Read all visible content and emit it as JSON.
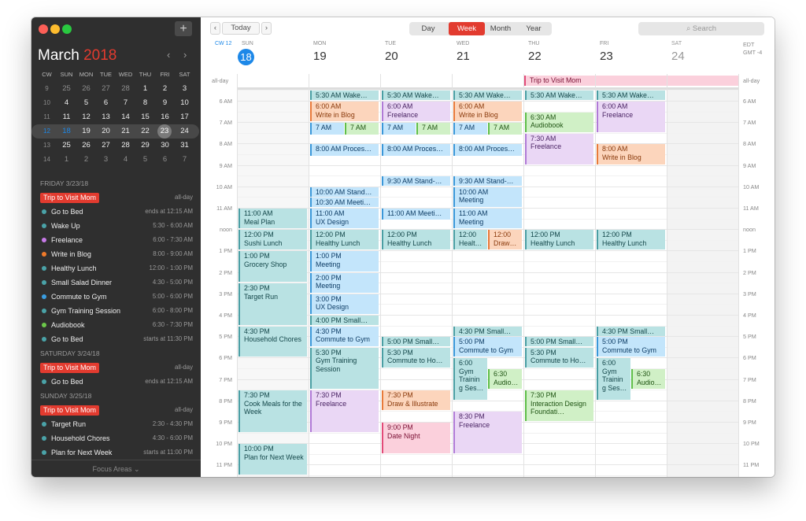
{
  "sidebar": {
    "month": "March",
    "year": "2018",
    "mini_headers": [
      "CW",
      "SUN",
      "MON",
      "TUE",
      "WED",
      "THU",
      "FRI",
      "SAT"
    ],
    "mini_weeks": [
      {
        "cw": "9",
        "days": [
          "25",
          "26",
          "27",
          "28",
          "1",
          "2",
          "3"
        ]
      },
      {
        "cw": "10",
        "days": [
          "4",
          "5",
          "6",
          "7",
          "8",
          "9",
          "10"
        ]
      },
      {
        "cw": "11",
        "days": [
          "11",
          "12",
          "13",
          "14",
          "15",
          "16",
          "17"
        ]
      },
      {
        "cw": "12",
        "days": [
          "18",
          "19",
          "20",
          "21",
          "22",
          "23",
          "24"
        ]
      },
      {
        "cw": "13",
        "days": [
          "25",
          "26",
          "27",
          "28",
          "29",
          "30",
          "31"
        ]
      },
      {
        "cw": "14",
        "days": [
          "1",
          "2",
          "3",
          "4",
          "5",
          "6",
          "7"
        ]
      }
    ],
    "agenda": [
      {
        "kind": "header",
        "text": "FRIDAY 3/23/18"
      },
      {
        "kind": "pill",
        "text": "Trip to Visit Mom",
        "time": "all-day"
      },
      {
        "kind": "item",
        "text": "Go to Bed",
        "time": "ends at 12:15 AM",
        "color": "#4aa3a8"
      },
      {
        "kind": "item",
        "text": "Wake Up",
        "time": "5:30 - 6:00 AM",
        "color": "#4aa3a8"
      },
      {
        "kind": "item",
        "text": "Freelance",
        "time": "6:00 - 7:30 AM",
        "color": "#c77ae8"
      },
      {
        "kind": "item",
        "text": "Write in Blog",
        "time": "8:00 - 9:00 AM",
        "color": "#f07a2a"
      },
      {
        "kind": "item",
        "text": "Healthy Lunch",
        "time": "12:00 - 1:00 PM",
        "color": "#4aa3a8"
      },
      {
        "kind": "item",
        "text": "Small Salad Dinner",
        "time": "4:30 - 5:00 PM",
        "color": "#4aa3a8"
      },
      {
        "kind": "item",
        "text": "Commute to Gym",
        "time": "5:00 - 6:00 PM",
        "color": "#3a9de0"
      },
      {
        "kind": "item",
        "text": "Gym Training Session",
        "time": "6:00 - 8:00 PM",
        "color": "#4aa3a8"
      },
      {
        "kind": "item",
        "text": "Audiobook",
        "time": "6:30 - 7:30 PM",
        "color": "#6cc84a"
      },
      {
        "kind": "item",
        "text": "Go to Bed",
        "time": "starts at 11:30 PM",
        "color": "#4aa3a8"
      },
      {
        "kind": "header",
        "text": "SATURDAY 3/24/18"
      },
      {
        "kind": "pill",
        "text": "Trip to Visit Mom",
        "time": "all-day"
      },
      {
        "kind": "item",
        "text": "Go to Bed",
        "time": "ends at 12:15 AM",
        "color": "#4aa3a8"
      },
      {
        "kind": "header",
        "text": "SUNDAY 3/25/18"
      },
      {
        "kind": "pill",
        "text": "Trip to Visit Mom",
        "time": "all-day"
      },
      {
        "kind": "item",
        "text": "Target Run",
        "time": "2:30 - 4:30 PM",
        "color": "#4aa3a8"
      },
      {
        "kind": "item",
        "text": "Household Chores",
        "time": "4:30 - 6:00 PM",
        "color": "#4aa3a8"
      },
      {
        "kind": "item",
        "text": "Plan for Next Week",
        "time": "starts at 11:00 PM",
        "color": "#4aa3a8"
      }
    ],
    "focus": "Focus Areas"
  },
  "toolbar": {
    "today": "Today",
    "views": [
      "Day",
      "Week",
      "Month",
      "Year"
    ],
    "active_view": "Week",
    "search": "Search"
  },
  "week": {
    "cw": "CW 12",
    "days": [
      {
        "w": "SUN",
        "d": "18"
      },
      {
        "w": "MON",
        "d": "19"
      },
      {
        "w": "TUE",
        "d": "20"
      },
      {
        "w": "WED",
        "d": "21"
      },
      {
        "w": "THU",
        "d": "22"
      },
      {
        "w": "FRI",
        "d": "23"
      },
      {
        "w": "SAT",
        "d": "24"
      }
    ],
    "tz": [
      "EDT",
      "GMT -4"
    ],
    "allday_label": "all-day",
    "hours": [
      "6 AM",
      "7 AM",
      "8 AM",
      "9 AM",
      "10 AM",
      "11 AM",
      "noon",
      "1 PM",
      "2 PM",
      "3 PM",
      "4 PM",
      "5 PM",
      "6 PM",
      "7 PM",
      "8 PM",
      "9 PM",
      "10 PM",
      "11 PM"
    ],
    "allday_event": "Trip to Visit Mom"
  },
  "events": [
    {
      "day": 0,
      "s": 11,
      "e": 12,
      "lane": 0,
      "lanes": 1,
      "c": "teal",
      "t": "11:00 AM",
      "n": "Meal Plan"
    },
    {
      "day": 0,
      "s": 12,
      "e": 13,
      "lane": 0,
      "lanes": 1,
      "c": "teal",
      "t": "12:00 PM",
      "n": "Sushi Lunch"
    },
    {
      "day": 0,
      "s": 13,
      "e": 14.5,
      "lane": 0,
      "lanes": 1,
      "c": "teal",
      "t": "1:00 PM",
      "n": "Grocery Shop"
    },
    {
      "day": 0,
      "s": 14.5,
      "e": 16.5,
      "lane": 0,
      "lanes": 1,
      "c": "teal",
      "t": "2:30 PM",
      "n": "Target Run"
    },
    {
      "day": 0,
      "s": 16.5,
      "e": 18,
      "lane": 0,
      "lanes": 1,
      "c": "teal",
      "t": "4:30 PM",
      "n": "Household Chores"
    },
    {
      "day": 0,
      "s": 19.5,
      "e": 21.5,
      "lane": 0,
      "lanes": 1,
      "c": "teal",
      "t": "7:30 PM",
      "n": "Cook Meals for the Week"
    },
    {
      "day": 0,
      "s": 22,
      "e": 23.5,
      "lane": 0,
      "lanes": 1,
      "c": "teal",
      "t": "10:00 PM",
      "n": "Plan for Next Week"
    },
    {
      "day": 1,
      "s": 5.5,
      "e": 6,
      "lane": 0,
      "lanes": 1,
      "c": "teal",
      "t": "",
      "n": "5:30 AM Wake…"
    },
    {
      "day": 1,
      "s": 6,
      "e": 7,
      "lane": 0,
      "lanes": 1,
      "c": "peach",
      "t": "6:00 AM",
      "n": "Write in Blog"
    },
    {
      "day": 1,
      "s": 7,
      "e": 7.6,
      "lane": 0,
      "lanes": 2,
      "c": "blue",
      "t": "",
      "n": "7 AM"
    },
    {
      "day": 1,
      "s": 7,
      "e": 7.6,
      "lane": 1,
      "lanes": 2,
      "c": "green",
      "t": "",
      "n": "7 AM"
    },
    {
      "day": 1,
      "s": 8,
      "e": 8.6,
      "lane": 0,
      "lanes": 1,
      "c": "blue",
      "t": "",
      "n": "8:00 AM Proces…"
    },
    {
      "day": 1,
      "s": 10,
      "e": 10.5,
      "lane": 0,
      "lanes": 1,
      "c": "blue",
      "t": "",
      "n": "10:00 AM Stand…"
    },
    {
      "day": 1,
      "s": 10.5,
      "e": 11,
      "lane": 0,
      "lanes": 1,
      "c": "blue",
      "t": "",
      "n": "10:30 AM Meeti…"
    },
    {
      "day": 1,
      "s": 11,
      "e": 12,
      "lane": 0,
      "lanes": 1,
      "c": "blue",
      "t": "11:00 AM",
      "n": "UX Design"
    },
    {
      "day": 1,
      "s": 12,
      "e": 13,
      "lane": 0,
      "lanes": 1,
      "c": "teal",
      "t": "12:00 PM",
      "n": "Healthy Lunch"
    },
    {
      "day": 1,
      "s": 13,
      "e": 14,
      "lane": 0,
      "lanes": 1,
      "c": "blue",
      "t": "1:00 PM",
      "n": "Meeting"
    },
    {
      "day": 1,
      "s": 14,
      "e": 15,
      "lane": 0,
      "lanes": 1,
      "c": "blue",
      "t": "2:00 PM",
      "n": "Meeting"
    },
    {
      "day": 1,
      "s": 15,
      "e": 16,
      "lane": 0,
      "lanes": 1,
      "c": "blue",
      "t": "3:00 PM",
      "n": "UX Design"
    },
    {
      "day": 1,
      "s": 16,
      "e": 16.5,
      "lane": 0,
      "lanes": 1,
      "c": "teal",
      "t": "",
      "n": "4:00 PM Small…"
    },
    {
      "day": 1,
      "s": 16.5,
      "e": 17.5,
      "lane": 0,
      "lanes": 1,
      "c": "blue",
      "t": "4:30 PM",
      "n": "Commute to Gym"
    },
    {
      "day": 1,
      "s": 17.5,
      "e": 19.5,
      "lane": 0,
      "lanes": 1,
      "c": "teal",
      "t": "5:30 PM",
      "n": "Gym Training Session"
    },
    {
      "day": 1,
      "s": 19.5,
      "e": 21.5,
      "lane": 0,
      "lanes": 1,
      "c": "lav",
      "t": "7:30 PM",
      "n": "Freelance"
    },
    {
      "day": 2,
      "s": 5.5,
      "e": 6,
      "lane": 0,
      "lanes": 1,
      "c": "teal",
      "t": "",
      "n": "5:30 AM Wake…"
    },
    {
      "day": 2,
      "s": 6,
      "e": 7,
      "lane": 0,
      "lanes": 1,
      "c": "lav",
      "t": "6:00 AM",
      "n": "Freelance"
    },
    {
      "day": 2,
      "s": 7,
      "e": 7.6,
      "lane": 0,
      "lanes": 2,
      "c": "blue",
      "t": "",
      "n": "7 AM"
    },
    {
      "day": 2,
      "s": 7,
      "e": 7.6,
      "lane": 1,
      "lanes": 2,
      "c": "green",
      "t": "",
      "n": "7 AM"
    },
    {
      "day": 2,
      "s": 8,
      "e": 8.6,
      "lane": 0,
      "lanes": 1,
      "c": "blue",
      "t": "",
      "n": "8:00 AM Proces…"
    },
    {
      "day": 2,
      "s": 9.5,
      "e": 10,
      "lane": 0,
      "lanes": 1,
      "c": "blue",
      "t": "",
      "n": "9:30 AM Stand-…"
    },
    {
      "day": 2,
      "s": 11,
      "e": 11.6,
      "lane": 0,
      "lanes": 1,
      "c": "blue",
      "t": "",
      "n": "11:00 AM Meeti…"
    },
    {
      "day": 2,
      "s": 12,
      "e": 13,
      "lane": 0,
      "lanes": 1,
      "c": "teal",
      "t": "12:00 PM",
      "n": "Healthy Lunch"
    },
    {
      "day": 2,
      "s": 17,
      "e": 17.5,
      "lane": 0,
      "lanes": 1,
      "c": "teal",
      "t": "",
      "n": "5:00 PM Small…"
    },
    {
      "day": 2,
      "s": 17.5,
      "e": 18.5,
      "lane": 0,
      "lanes": 1,
      "c": "teal",
      "t": "5:30 PM",
      "n": "Commute to Ho…"
    },
    {
      "day": 2,
      "s": 19.5,
      "e": 20.5,
      "lane": 0,
      "lanes": 1,
      "c": "peach",
      "t": "7:30 PM",
      "n": "Draw & Illustrate"
    },
    {
      "day": 2,
      "s": 21,
      "e": 22.5,
      "lane": 0,
      "lanes": 1,
      "c": "pink",
      "t": "9:00 PM",
      "n": "Date Night"
    },
    {
      "day": 3,
      "s": 5.5,
      "e": 6,
      "lane": 0,
      "lanes": 1,
      "c": "teal",
      "t": "",
      "n": "5:30 AM Wake…"
    },
    {
      "day": 3,
      "s": 6,
      "e": 7,
      "lane": 0,
      "lanes": 1,
      "c": "peach",
      "t": "6:00 AM",
      "n": "Write in Blog"
    },
    {
      "day": 3,
      "s": 7,
      "e": 7.6,
      "lane": 0,
      "lanes": 2,
      "c": "blue",
      "t": "",
      "n": "7 AM"
    },
    {
      "day": 3,
      "s": 7,
      "e": 7.6,
      "lane": 1,
      "lanes": 2,
      "c": "green",
      "t": "",
      "n": "7 AM"
    },
    {
      "day": 3,
      "s": 8,
      "e": 8.6,
      "lane": 0,
      "lanes": 1,
      "c": "blue",
      "t": "",
      "n": "8:00 AM Proces…"
    },
    {
      "day": 3,
      "s": 9.5,
      "e": 10,
      "lane": 0,
      "lanes": 1,
      "c": "blue",
      "t": "",
      "n": "9:30 AM Stand-…"
    },
    {
      "day": 3,
      "s": 10,
      "e": 11,
      "lane": 0,
      "lanes": 1,
      "c": "blue",
      "t": "10:00 AM",
      "n": "Meeting"
    },
    {
      "day": 3,
      "s": 11,
      "e": 12,
      "lane": 0,
      "lanes": 1,
      "c": "blue",
      "t": "11:00 AM",
      "n": "Meeting"
    },
    {
      "day": 3,
      "s": 12,
      "e": 13,
      "lane": 0,
      "lanes": 2,
      "c": "teal",
      "t": "12:00",
      "n": "Healt…"
    },
    {
      "day": 3,
      "s": 12,
      "e": 13,
      "lane": 1,
      "lanes": 2,
      "c": "peach",
      "t": "12:00",
      "n": "Draw…"
    },
    {
      "day": 3,
      "s": 16.5,
      "e": 17,
      "lane": 0,
      "lanes": 1,
      "c": "teal",
      "t": "",
      "n": "4:30 PM Small…"
    },
    {
      "day": 3,
      "s": 17,
      "e": 18,
      "lane": 0,
      "lanes": 1,
      "c": "blue",
      "t": "5:00 PM",
      "n": "Commute to Gym"
    },
    {
      "day": 3,
      "s": 18,
      "e": 20,
      "lane": 0,
      "lanes": 2,
      "c": "teal",
      "t": "6:00",
      "n": "Gym Trainin g Ses…"
    },
    {
      "day": 3,
      "s": 18.5,
      "e": 19.5,
      "lane": 1,
      "lanes": 2,
      "c": "green",
      "t": "6:30",
      "n": "Audio…"
    },
    {
      "day": 3,
      "s": 20.5,
      "e": 22.5,
      "lane": 0,
      "lanes": 1,
      "c": "lav",
      "t": "8:30 PM",
      "n": "Freelance"
    },
    {
      "day": 4,
      "s": 5.5,
      "e": 6,
      "lane": 0,
      "lanes": 1,
      "c": "teal",
      "t": "",
      "n": "5:30 AM Wake…"
    },
    {
      "day": 4,
      "s": 6.5,
      "e": 7.5,
      "lane": 0,
      "lanes": 1,
      "c": "green",
      "t": "6:30 AM",
      "n": "Audiobook"
    },
    {
      "day": 4,
      "s": 7.5,
      "e": 9,
      "lane": 0,
      "lanes": 1,
      "c": "lav",
      "t": "7:30 AM",
      "n": "Freelance"
    },
    {
      "day": 4,
      "s": 12,
      "e": 13,
      "lane": 0,
      "lanes": 1,
      "c": "teal",
      "t": "12:00 PM",
      "n": "Healthy Lunch"
    },
    {
      "day": 4,
      "s": 17,
      "e": 17.5,
      "lane": 0,
      "lanes": 1,
      "c": "teal",
      "t": "",
      "n": "5:00 PM Small…"
    },
    {
      "day": 4,
      "s": 17.5,
      "e": 18.5,
      "lane": 0,
      "lanes": 1,
      "c": "teal",
      "t": "5:30 PM",
      "n": "Commute to Ho…"
    },
    {
      "day": 4,
      "s": 19.5,
      "e": 21,
      "lane": 0,
      "lanes": 1,
      "c": "green",
      "t": "7:30 PM",
      "n": "Interaction Design Foundati…"
    },
    {
      "day": 5,
      "s": 5.5,
      "e": 6,
      "lane": 0,
      "lanes": 1,
      "c": "teal",
      "t": "",
      "n": "5:30 AM Wake…"
    },
    {
      "day": 5,
      "s": 6,
      "e": 7.5,
      "lane": 0,
      "lanes": 1,
      "c": "lav",
      "t": "6:00 AM",
      "n": "Freelance"
    },
    {
      "day": 5,
      "s": 8,
      "e": 9,
      "lane": 0,
      "lanes": 1,
      "c": "peach",
      "t": "8:00 AM",
      "n": "Write in Blog"
    },
    {
      "day": 5,
      "s": 12,
      "e": 13,
      "lane": 0,
      "lanes": 1,
      "c": "teal",
      "t": "12:00 PM",
      "n": "Healthy Lunch"
    },
    {
      "day": 5,
      "s": 16.5,
      "e": 17,
      "lane": 0,
      "lanes": 1,
      "c": "teal",
      "t": "",
      "n": "4:30 PM Small…"
    },
    {
      "day": 5,
      "s": 17,
      "e": 18,
      "lane": 0,
      "lanes": 1,
      "c": "blue",
      "t": "5:00 PM",
      "n": "Commute to Gym"
    },
    {
      "day": 5,
      "s": 18,
      "e": 20,
      "lane": 0,
      "lanes": 2,
      "c": "teal",
      "t": "6:00",
      "n": "Gym Trainin g Ses…"
    },
    {
      "day": 5,
      "s": 18.5,
      "e": 19.5,
      "lane": 1,
      "lanes": 2,
      "c": "green",
      "t": "6:30",
      "n": "Audio…"
    }
  ]
}
